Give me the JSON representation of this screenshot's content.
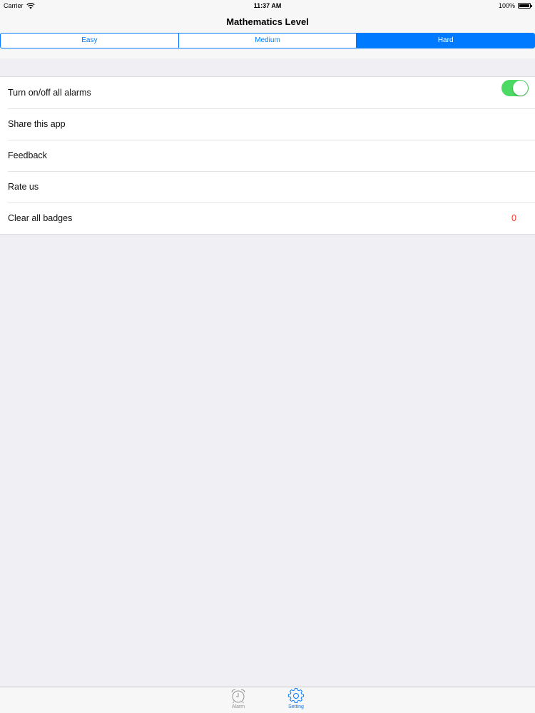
{
  "status_bar": {
    "carrier": "Carrier",
    "time": "11:37 AM",
    "battery": "100%"
  },
  "header": {
    "title": "Mathematics Level"
  },
  "level_segments": [
    {
      "label": "Easy",
      "selected": false
    },
    {
      "label": "Medium",
      "selected": false
    },
    {
      "label": "Hard",
      "selected": true
    }
  ],
  "settings": {
    "alarms_toggle_label": "Turn on/off all alarms",
    "alarms_enabled": true,
    "share_label": "Share this app",
    "feedback_label": "Feedback",
    "rate_label": "Rate us",
    "clear_badges_label": "Clear all badges",
    "badge_count": "0"
  },
  "tab_bar": {
    "tabs": [
      {
        "label": "Alarm",
        "icon": "alarm-clock-icon",
        "selected": false
      },
      {
        "label": "Setting",
        "icon": "gear-icon",
        "selected": true
      }
    ]
  },
  "colors": {
    "accent": "#007aff",
    "toggle_on": "#4cd964",
    "badge": "#ff3b30",
    "inactive_tab": "#929292",
    "background": "#efeff4"
  }
}
